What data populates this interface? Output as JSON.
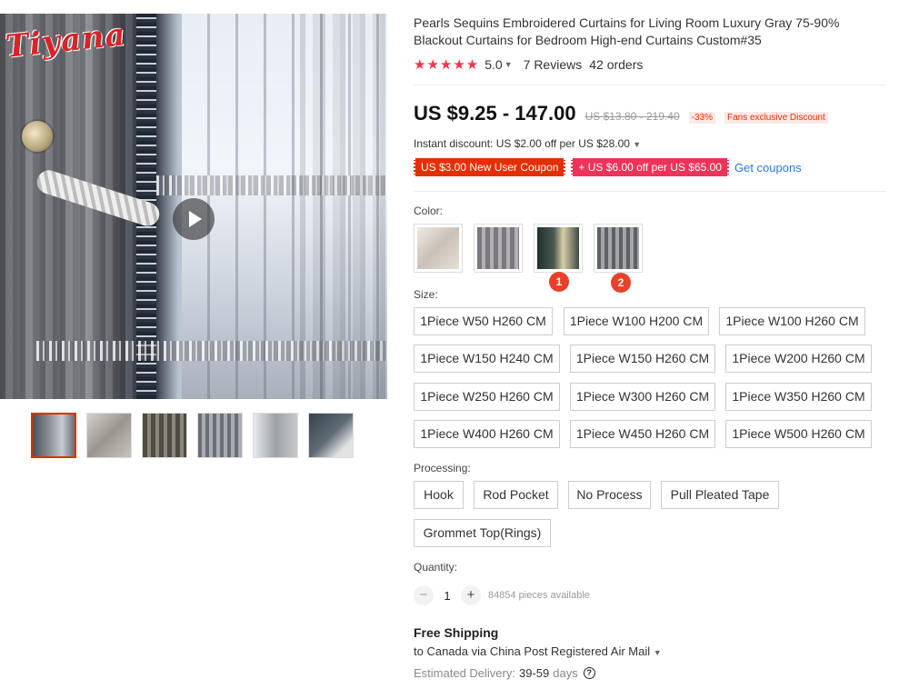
{
  "gallery": {
    "logo_text": "Tiyana",
    "thumbnails": [
      {
        "icon": "curtain-video-thumbnail",
        "color": "#6b6e75"
      },
      {
        "icon": "curtain-photo-thumbnail",
        "color": "#b7b2ab"
      },
      {
        "icon": "curtain-photo-thumbnail",
        "color": "#6d6a60"
      },
      {
        "icon": "curtain-photo-thumbnail",
        "color": "#8a8d94"
      },
      {
        "icon": "curtain-photo-thumbnail",
        "color": "#a7a9ad"
      },
      {
        "icon": "curtain-photo-thumbnail",
        "color": "#4d5963"
      }
    ]
  },
  "product": {
    "title": "Pearls Sequins Embroidered Curtains for Living Room Luxury Gray 75-90% Blackout Curtains for Bedroom High-end Curtains Custom#35",
    "stars": "★★★★★",
    "rating": "5.0",
    "reviews": "7 Reviews",
    "orders": "42 orders"
  },
  "price": {
    "current": "US $9.25 - 147.00",
    "original": "US $13.80 - 219.40",
    "discount": "-33%",
    "fans_badge": "Fans exclusive Discount"
  },
  "promotions": {
    "instant_discount": "Instant discount: US $2.00 off per US $28.00",
    "coupon_1": "US $3.00 New User Coupon",
    "coupon_2": "+ US $6.00 off per US $65.00",
    "get_coupons": "Get coupons"
  },
  "color": {
    "label": "Color:",
    "options": [
      {
        "icon": "color-swatch-embroidery",
        "color": "#d9d2cb"
      },
      {
        "icon": "color-swatch-gray-sheer",
        "color": "#8e8b90"
      },
      {
        "icon": "color-swatch-dark-embroidered",
        "color": "#3e4a44"
      },
      {
        "icon": "color-swatch-gray-striped",
        "color": "#7e7f83"
      }
    ],
    "badges": [
      "1",
      "2"
    ]
  },
  "size": {
    "label": "Size:",
    "options": [
      "1Piece W50 H260 CM",
      "1Piece W100 H200 CM",
      "1Piece W100 H260 CM",
      "1Piece W150 H240 CM",
      "1Piece W150 H260 CM",
      "1Piece W200 H260 CM",
      "1Piece W250 H260 CM",
      "1Piece W300 H260 CM",
      "1Piece W350 H260 CM",
      "1Piece W400 H260 CM",
      "1Piece W450 H260 CM",
      "1Piece W500 H260 CM"
    ]
  },
  "processing": {
    "label": "Processing:",
    "options": [
      "Hook",
      "Rod Pocket",
      "No Process",
      "Pull Pleated Tape",
      "Grommet Top(Rings)"
    ]
  },
  "quantity": {
    "label": "Quantity:",
    "minus": "−",
    "value": "1",
    "plus": "+",
    "available": "84854 pieces available"
  },
  "shipping": {
    "title": "Free Shipping",
    "destination": "to Canada via China Post Registered Air Mail",
    "estimated_label": "Estimated Delivery:",
    "estimated_value": "39-59",
    "days": "days",
    "help": "?"
  },
  "colors": {
    "accent": "#e62e04",
    "star": "#f5344a",
    "link": "#2a7ad1",
    "badge": "#e8402a"
  }
}
